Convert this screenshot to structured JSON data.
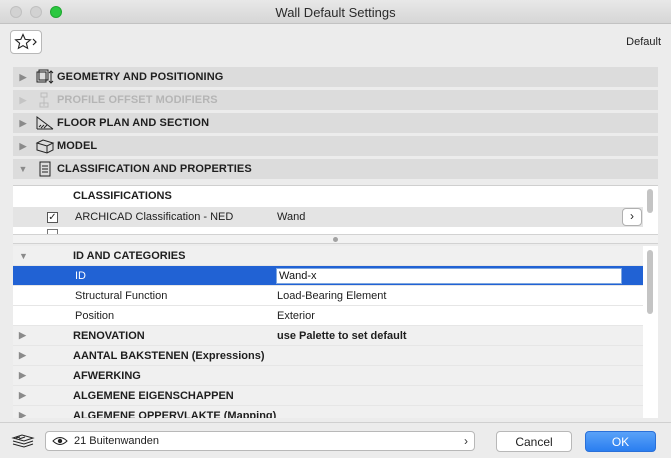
{
  "window": {
    "title": "Wall Default Settings"
  },
  "favorites": {
    "default_label": "Default"
  },
  "sections": [
    {
      "label": "GEOMETRY AND POSITIONING",
      "expanded": false,
      "disabled": false
    },
    {
      "label": "PROFILE OFFSET MODIFIERS",
      "expanded": false,
      "disabled": true
    },
    {
      "label": "FLOOR PLAN AND SECTION",
      "expanded": false,
      "disabled": false
    },
    {
      "label": "MODEL",
      "expanded": false,
      "disabled": false
    },
    {
      "label": "CLASSIFICATION AND PROPERTIES",
      "expanded": true,
      "disabled": false
    }
  ],
  "classifications": {
    "header": "CLASSIFICATIONS",
    "rows": [
      {
        "checked": true,
        "system": "ARCHICAD Classification - NED",
        "value": "Wand"
      }
    ]
  },
  "properties": {
    "id_group": {
      "label": "ID AND CATEGORIES",
      "rows": [
        {
          "name": "ID",
          "value": "Wand-x"
        },
        {
          "name": "Structural Function",
          "value": "Load-Bearing Element"
        },
        {
          "name": "Position",
          "value": "Exterior"
        }
      ]
    },
    "groups": [
      {
        "label": "RENOVATION",
        "value": "use Palette to set default"
      },
      {
        "label": "AANTAL BAKSTENEN (Expressions)",
        "value": ""
      },
      {
        "label": "AFWERKING",
        "value": ""
      },
      {
        "label": "ALGEMENE EIGENSCHAPPEN",
        "value": ""
      },
      {
        "label": "ALGEMENE OPPERVLAKTE (Mapping)",
        "value": ""
      }
    ]
  },
  "footer": {
    "layer": "21 Buitenwanden",
    "cancel_label": "Cancel",
    "ok_label": "OK"
  },
  "colors": {
    "accent": "#2162d4",
    "ok_button": "#2a7ef0"
  }
}
